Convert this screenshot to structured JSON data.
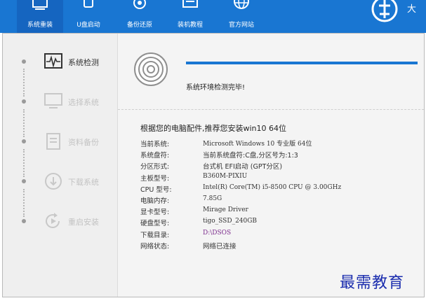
{
  "colors": {
    "accent": "#1976d2",
    "active_tab": "#1565c0",
    "download_dir": "#7b2b8c",
    "watermark": "#1b2dae"
  },
  "nav": {
    "tabs": [
      {
        "label": "系统重装",
        "icon": "monitor-icon",
        "active": true
      },
      {
        "label": "U盘启动",
        "icon": "usb-drive-icon",
        "active": false
      },
      {
        "label": "备份还原",
        "icon": "backup-restore-icon",
        "active": false
      },
      {
        "label": "装机教程",
        "icon": "tutorial-icon",
        "active": false
      },
      {
        "label": "官方网站",
        "icon": "globe-icon",
        "active": false
      }
    ],
    "logo_icon": "logo-icon",
    "brand_fragment": "大"
  },
  "steps": [
    {
      "label": "系统检测",
      "icon": "waveform-icon",
      "active": true
    },
    {
      "label": "选择系统",
      "icon": "monitor-icon",
      "active": false
    },
    {
      "label": "资料备份",
      "icon": "document-icon",
      "active": false
    },
    {
      "label": "下载系统",
      "icon": "download-icon",
      "active": false
    },
    {
      "label": "重启安装",
      "icon": "restart-icon",
      "active": false
    }
  ],
  "detection": {
    "progress": 1.0,
    "status": "系统环境检测完毕!",
    "recommendation": "根据您的电脑配件,推荐您安装win10 64位"
  },
  "info": [
    {
      "key": "当前系统:",
      "value": "Microsoft Windows 10 专业版  64位"
    },
    {
      "key": "系统盘符:",
      "value": "当前系统盘符:C盘,分区号为:1:3"
    },
    {
      "key": "分区形式:",
      "value": "台式机 EFI启动 (GPT分区)"
    },
    {
      "key": "主板型号:",
      "value": "B360M-PIXIU"
    },
    {
      "key": "CPU 型号:",
      "value": "Intel(R) Core(TM) i5-8500 CPU @ 3.00GHz"
    },
    {
      "key": "电脑内存:",
      "value": "7.85G"
    },
    {
      "key": "显卡型号:",
      "value": "Mirage Driver"
    },
    {
      "key": "硬盘型号:",
      "value": "tigo_SSD_240GB"
    },
    {
      "key": "下载目录:",
      "value": "D:\\DSOS"
    },
    {
      "key": "网络状态:",
      "value": "网络已连接"
    }
  ],
  "watermark": "最需教育"
}
